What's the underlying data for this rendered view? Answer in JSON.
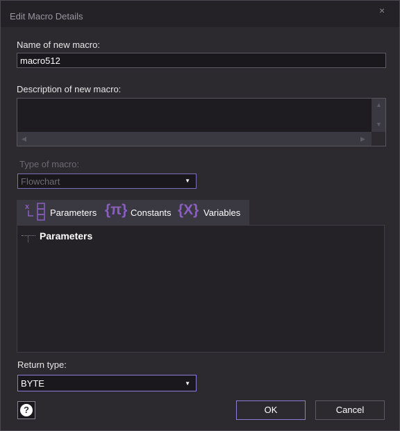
{
  "window": {
    "title": "Edit Macro Details",
    "close_glyph": "×"
  },
  "name_field": {
    "label": "Name of new macro:",
    "value": "macro512"
  },
  "description_field": {
    "label": "Description of new macro:",
    "value": ""
  },
  "type_field": {
    "label": "Type of macro:",
    "selected": "Flowchart",
    "enabled": false
  },
  "tabs": [
    {
      "label": "Parameters",
      "icon": "parameters-icon"
    },
    {
      "label": "Constants",
      "icon": "pi-constants-icon",
      "glyph": "{π}"
    },
    {
      "label": "Variables",
      "icon": "x-variables-icon",
      "glyph": "{X}"
    }
  ],
  "tree": {
    "root_label": "Parameters"
  },
  "return_type": {
    "label": "Return type:",
    "selected": "BYTE"
  },
  "buttons": {
    "ok": "OK",
    "cancel": "Cancel",
    "help_glyph": "?"
  },
  "colors": {
    "accent": "#8a7fd0",
    "icon_purple": "#8a5fc0",
    "background": "#2c2a2f"
  }
}
